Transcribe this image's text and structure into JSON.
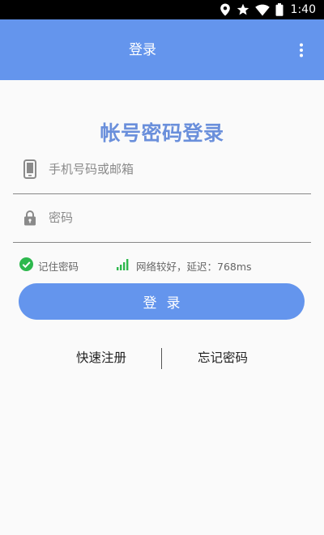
{
  "status_bar": {
    "time": "1:40",
    "icons": [
      "location-icon",
      "star-icon",
      "wifi-icon",
      "battery-icon"
    ]
  },
  "app_bar": {
    "title": "登录",
    "menu_icon": "more-vert-icon",
    "background": "#6495ed"
  },
  "heading": "帐号密码登录",
  "account_field": {
    "placeholder": "手机号码或邮箱",
    "value": "",
    "icon": "phone-icon"
  },
  "password_field": {
    "placeholder": "密码",
    "value": "",
    "icon": "lock-icon"
  },
  "remember": {
    "label": "记住密码",
    "checked": true,
    "icon": "check-circle-icon",
    "color": "#2db84d"
  },
  "network": {
    "label": "网络较好，延迟：768ms",
    "icon": "signal-bars-icon",
    "color": "#2db84d"
  },
  "login_button": {
    "label": "登录"
  },
  "links": {
    "register": "快速注册",
    "forgot": "忘记密码"
  },
  "colors": {
    "accent": "#6495ed",
    "heading": "#6a8fdb",
    "success": "#2db84d"
  }
}
